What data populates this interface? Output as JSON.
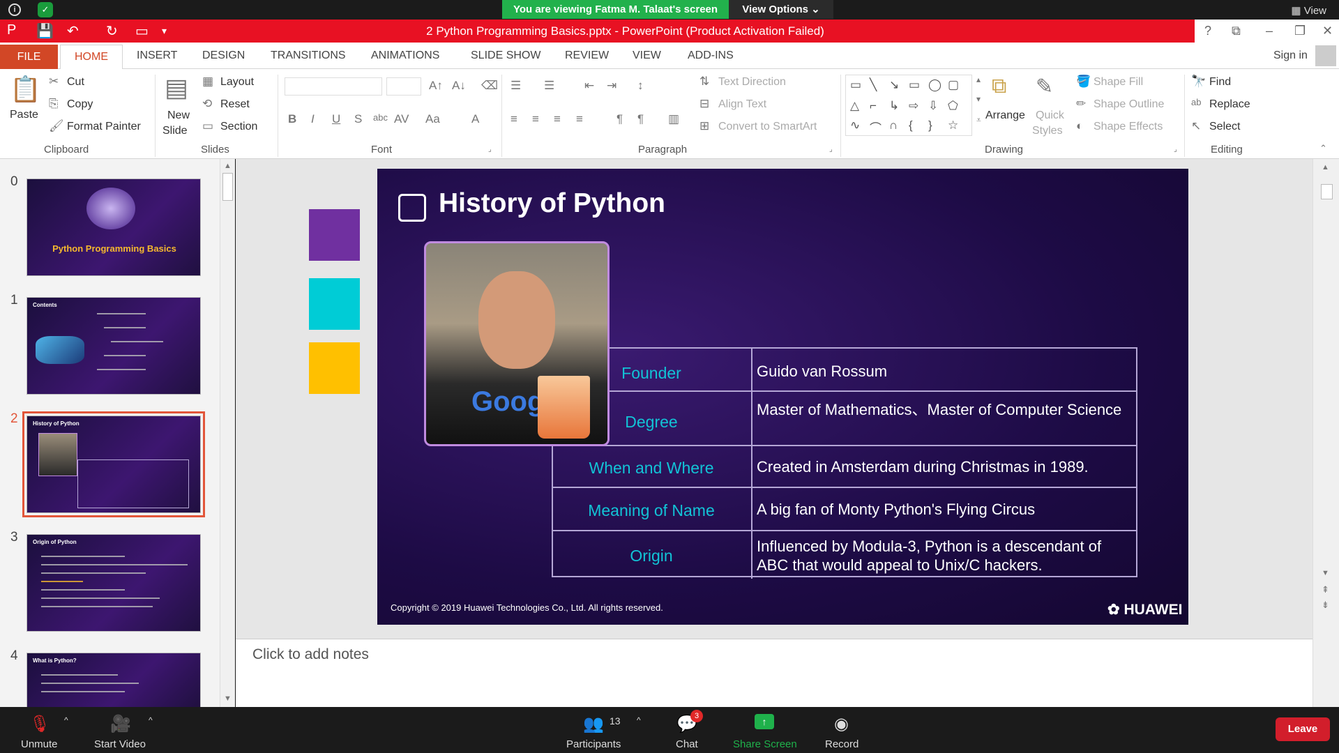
{
  "zoom_top": {
    "banner": "You are viewing Fatma M. Talaat's screen",
    "view_options": "View Options",
    "view": "View"
  },
  "window": {
    "title": "2 Python Programming Basics.pptx -  PowerPoint (Product Activation Failed)",
    "sign_in": "Sign in",
    "help": "?"
  },
  "tabs": [
    "FILE",
    "HOME",
    "INSERT",
    "DESIGN",
    "TRANSITIONS",
    "ANIMATIONS",
    "SLIDE SHOW",
    "REVIEW",
    "VIEW",
    "ADD-INS"
  ],
  "ribbon": {
    "clipboard": {
      "paste": "Paste",
      "cut": "Cut",
      "copy": "Copy",
      "format_painter": "Format Painter",
      "label": "Clipboard"
    },
    "slides": {
      "new_slide_1": "New",
      "new_slide_2": "Slide",
      "layout": "Layout",
      "reset": "Reset",
      "section": "Section",
      "label": "Slides"
    },
    "font": {
      "label": "Font"
    },
    "paragraph": {
      "text_direction": "Text Direction",
      "align_text": "Align Text",
      "convert_smartart": "Convert to SmartArt",
      "label": "Paragraph"
    },
    "drawing": {
      "arrange": "Arrange",
      "quick_styles_1": "Quick",
      "quick_styles_2": "Styles",
      "shape_fill": "Shape Fill",
      "shape_outline": "Shape Outline",
      "shape_effects": "Shape Effects",
      "label": "Drawing"
    },
    "editing": {
      "find": "Find",
      "replace": "Replace",
      "select": "Select",
      "label": "Editing"
    }
  },
  "slides_panel": [
    {
      "num": "0",
      "title": "Python Programming Basics"
    },
    {
      "num": "1",
      "title": "Contents"
    },
    {
      "num": "2",
      "title": "History of Python"
    },
    {
      "num": "3",
      "title": "Origin of Python"
    },
    {
      "num": "4",
      "title": "What is Python?"
    }
  ],
  "slide": {
    "title": "History of Python",
    "photo_shirt_text": "Goog",
    "rows": [
      {
        "key": "Founder",
        "value": "Guido van Rossum"
      },
      {
        "key": "Degree",
        "value": "Master of Mathematics、Master of Computer Science"
      },
      {
        "key": "When and Where",
        "value": "Created in Amsterdam during Christmas in 1989."
      },
      {
        "key": "Meaning of Name",
        "value": "A big fan of Monty Python's Flying Circus"
      },
      {
        "key": "Origin",
        "value": "Influenced by Modula-3, Python is a descendant of ABC that would appeal to Unix/C hackers."
      }
    ],
    "copyright": "Copyright © 2019 Huawei Technologies Co., Ltd. All rights reserved.",
    "logo": "HUAWEI",
    "swatch_colors": [
      "#7030a0",
      "#00ccd6",
      "#ffc000"
    ]
  },
  "notes": {
    "placeholder": "Click to add notes"
  },
  "zoom_bar": {
    "unmute": "Unmute",
    "start_video": "Start Video",
    "participants": "Participants",
    "participants_count": "13",
    "chat": "Chat",
    "chat_badge": "3",
    "share_screen": "Share Screen",
    "record": "Record",
    "leave": "Leave"
  }
}
